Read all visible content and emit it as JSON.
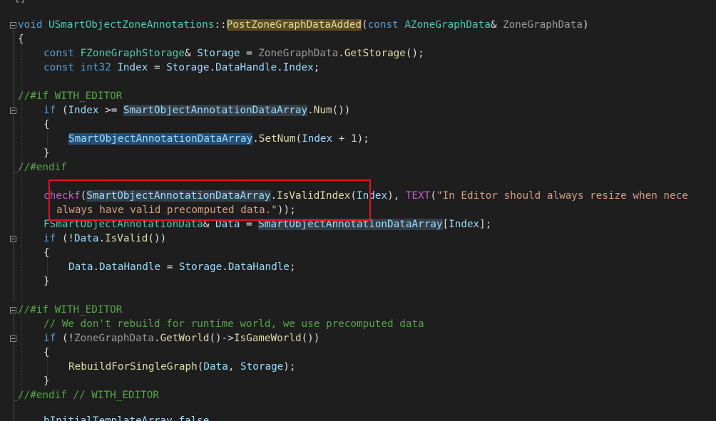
{
  "editor": {
    "top_fragment": "[}",
    "lines": {
      "l1_void": "void ",
      "l1_class": "USmartObjectZoneAnnotations",
      "l1_sep": "::",
      "l1_func": "PostZoneGraphDataAdded",
      "l1_paren_open": "(",
      "l1_const": "const ",
      "l1_type": "AZoneGraphData",
      "l1_amp": "& ",
      "l1_param": "ZoneGraphData",
      "l1_close": ")",
      "l2_brace": "{",
      "l3_const": "const ",
      "l3_type": "FZoneGraphStorage",
      "l3_amp": "& ",
      "l3_var": "Storage",
      "l3_eq": " = ",
      "l3_obj": "ZoneGraphData",
      "l3_dot": ".",
      "l3_call": "GetStorage",
      "l3_end": "();",
      "l4_const": "const ",
      "l4_type": "int32",
      "l4_sp": " ",
      "l4_var": "Index",
      "l4_eq": " = ",
      "l4_obj": "Storage",
      "l4_dot1": ".",
      "l4_mem": "DataHandle",
      "l4_dot2": ".",
      "l4_mem2": "Index",
      "l4_end": ";",
      "l6_text": "//#if WITH_EDITOR",
      "l7_if": "if",
      "l7_open": " (",
      "l7_var": "Index",
      "l7_op": " >= ",
      "l7_arr": "SmartObjectAnnotationDataArray",
      "l7_dot": ".",
      "l7_call": "Num",
      "l7_end": "())",
      "l8_brace": "{",
      "l9_arr": "SmartObjectAnnotationDataArray",
      "l9_dot": ".",
      "l9_call": "SetNum",
      "l9_open": "(",
      "l9_var": "Index",
      "l9_rest": " + 1);",
      "l10_brace": "}",
      "l11_text": "//#endif",
      "l13_macro": "checkf",
      "l13_open": "(",
      "l13_arr": "SmartObjectAnnotationDataArray",
      "l13_dot": ".",
      "l13_call": "IsValidIndex",
      "l13_open2": "(",
      "l13_var": "Index",
      "l13_mid": "), ",
      "l13_text_macro": "TEXT",
      "l13_open3": "(",
      "l13_str": "\"In Editor should always resize when nece",
      "l14_str": "always have valid precomputed data.\"",
      "l14_end": "));",
      "l15_type": "FSmartObjectAnnotationData",
      "l15_amp": "& ",
      "l15_var": "Data",
      "l15_eq": " = ",
      "l15_arr": "SmartObjectAnnotationDataArray",
      "l15_open": "[",
      "l15_idx": "Index",
      "l15_end": "];",
      "l16_if": "if",
      "l16_open": " (!",
      "l16_var": "Data",
      "l16_dot": ".",
      "l16_call": "IsValid",
      "l16_end": "())",
      "l17_brace": "{",
      "l18_var": "Data",
      "l18_dot1": ".",
      "l18_mem": "DataHandle",
      "l18_eq": " = ",
      "l18_obj": "Storage",
      "l18_dot2": ".",
      "l18_mem2": "DataHandle",
      "l18_end": ";",
      "l19_brace": "}",
      "l21_text": "//#if WITH_EDITOR",
      "l22_text": "// We don't rebuild for runtime world, we use precomputed data",
      "l23_if": "if",
      "l23_open": " (!",
      "l23_obj": "ZoneGraphData",
      "l23_dot": ".",
      "l23_call": "GetWorld",
      "l23_arrow": "()->",
      "l23_call2": "IsGameWorld",
      "l23_end": "())",
      "l24_brace": "{",
      "l25_call": "RebuildForSingleGraph",
      "l25_open": "(",
      "l25_a1": "Data",
      "l25_comma": ", ",
      "l25_a2": "Storage",
      "l25_end": ");",
      "l26_brace": "}",
      "l27_text": "//#endif // WITH_EDITOR",
      "l29_partial": "bInitialTemplateArray_false"
    }
  },
  "colors": {
    "background": "#1e1e1e",
    "keyword": "#569cd6",
    "type": "#4ec9b0",
    "function": "#dcdcaa",
    "comment": "#57a64a",
    "string": "#d69d85",
    "highlight_box": "#e81123"
  }
}
